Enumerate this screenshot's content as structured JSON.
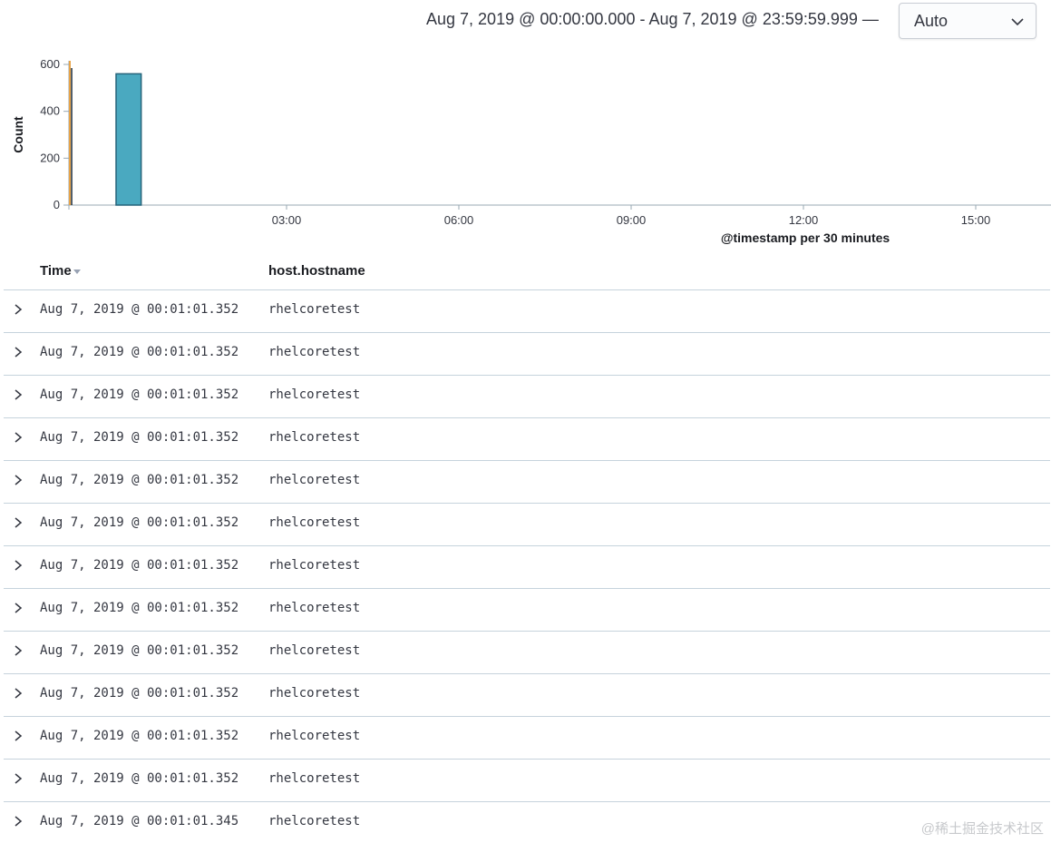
{
  "header": {
    "date_range": "Aug 7, 2019 @ 00:00:00.000 - Aug 7, 2019 @ 23:59:59.999 —",
    "interval_value": "Auto"
  },
  "colors": {
    "bar_fill": "#4aa9c0",
    "bar_stroke": "#25637a",
    "marker": "#e7a44a",
    "axis": "#98a8b3"
  },
  "chart_data": {
    "type": "bar",
    "ylabel": "Count",
    "xlabel": "@timestamp per 30 minutes",
    "y_ticks": [
      "0",
      "200",
      "400",
      "600"
    ],
    "ylim": [
      0,
      600
    ],
    "x_ticks": [
      "03:00",
      "06:00",
      "09:00",
      "12:00",
      "15:00"
    ],
    "bars": [
      {
        "x": "00:00",
        "value": 560
      }
    ]
  },
  "table": {
    "columns": {
      "time": "Time",
      "host": "host.hostname"
    },
    "rows": [
      {
        "time": "Aug 7, 2019 @ 00:01:01.352",
        "host": "rhelcoretest"
      },
      {
        "time": "Aug 7, 2019 @ 00:01:01.352",
        "host": "rhelcoretest"
      },
      {
        "time": "Aug 7, 2019 @ 00:01:01.352",
        "host": "rhelcoretest"
      },
      {
        "time": "Aug 7, 2019 @ 00:01:01.352",
        "host": "rhelcoretest"
      },
      {
        "time": "Aug 7, 2019 @ 00:01:01.352",
        "host": "rhelcoretest"
      },
      {
        "time": "Aug 7, 2019 @ 00:01:01.352",
        "host": "rhelcoretest"
      },
      {
        "time": "Aug 7, 2019 @ 00:01:01.352",
        "host": "rhelcoretest"
      },
      {
        "time": "Aug 7, 2019 @ 00:01:01.352",
        "host": "rhelcoretest"
      },
      {
        "time": "Aug 7, 2019 @ 00:01:01.352",
        "host": "rhelcoretest"
      },
      {
        "time": "Aug 7, 2019 @ 00:01:01.352",
        "host": "rhelcoretest"
      },
      {
        "time": "Aug 7, 2019 @ 00:01:01.352",
        "host": "rhelcoretest"
      },
      {
        "time": "Aug 7, 2019 @ 00:01:01.352",
        "host": "rhelcoretest"
      },
      {
        "time": "Aug 7, 2019 @ 00:01:01.345",
        "host": "rhelcoretest"
      }
    ]
  },
  "watermark": "@稀土掘金技术社区"
}
